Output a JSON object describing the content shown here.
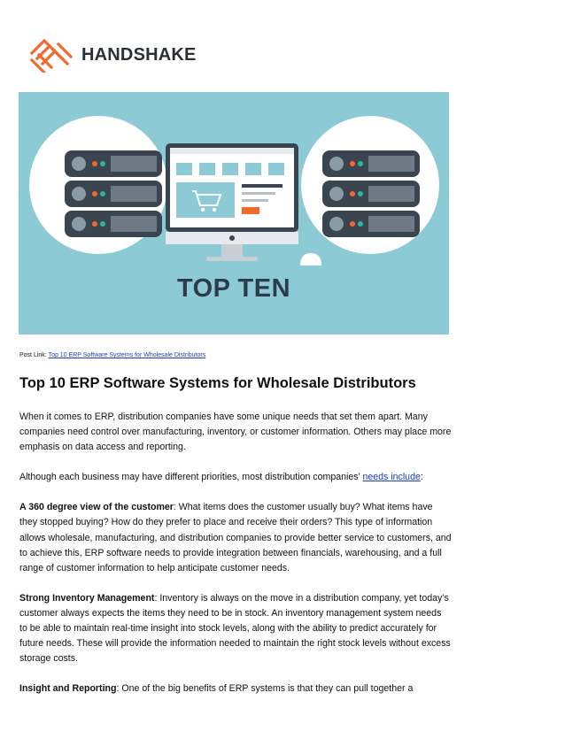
{
  "logo": {
    "text": "HANDSHAKE"
  },
  "hero": {
    "title": "TOP TEN"
  },
  "post_link": {
    "label": "Post Link:",
    "link_text": "Top 10 ERP Software Systems for Wholesale Distributors"
  },
  "article": {
    "title": "Top 10 ERP Software Systems for Wholesale Distributors",
    "intro": "When it comes to ERP, distribution companies have some unique needs that set them apart. Many companies need control over manufacturing, inventory, or customer information. Others may place more emphasis on data access and reporting.",
    "priorities_before": "Although each business may have different priorities, most distribution companies’ ",
    "priorities_link": "needs include",
    "priorities_after": ":",
    "sections": [
      {
        "heading": "A 360 degree view of the customer",
        "text": ": What items does the customer usually buy? What items have they stopped buying? How do they prefer to place and receive their orders? This type of information allows wholesale, manufacturing, and distribution companies to provide better service to customers, and to achieve this, ERP software needs to provide integration between financials, warehousing, and a full range of customer information to help anticipate customer needs."
      },
      {
        "heading": "Strong Inventory Management",
        "text": ": Inventory is always on the move in a distribution company, yet today’s customer always expects the items they need to be in stock. An inventory management system needs to be able to maintain real-time insight into stock levels, along with the ability to predict accurately for future needs. These will provide the information needed to maintain the right stock levels without excess storage costs."
      },
      {
        "heading": "Insight and Reporting",
        "text": ": One of the big benefits of ERP systems is that they can pull together a"
      }
    ]
  }
}
